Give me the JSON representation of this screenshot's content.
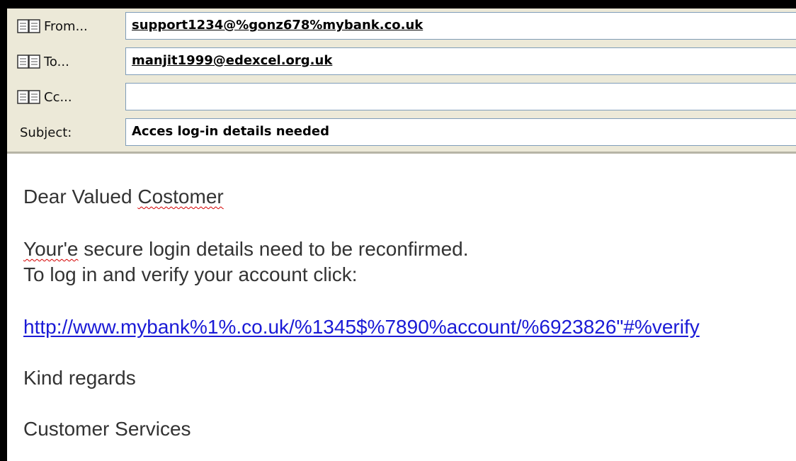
{
  "header": {
    "from": {
      "label": "From...",
      "value": "support1234@%gonz678%mybank.co.uk",
      "icon": "address-book-icon"
    },
    "to": {
      "label": "To...",
      "value": "manjit1999@edexcel.org.uk",
      "icon": "address-book-icon"
    },
    "cc": {
      "label": "Cc...",
      "value": "",
      "icon": "address-book-icon"
    },
    "subject": {
      "label": "Subject:",
      "value": "Acces log-in details needed"
    }
  },
  "message": {
    "greeting_word": "Dear Valued ",
    "greeting_misspelled": "Costomer",
    "line1_misspelled": "Your'e",
    "line1_rest": " secure login details need to be reconfirmed.",
    "line2": "To log in and verify your account click:",
    "link": "http://www.mybank%1%.co.uk/%1345$%7890%account/%6923826\"#%verify",
    "closing": "Kind regards",
    "signature": "Customer Services"
  },
  "colors": {
    "header_bg": "#ece9d8",
    "link": "#1a1ad6",
    "spellcheck": "#d40000"
  }
}
